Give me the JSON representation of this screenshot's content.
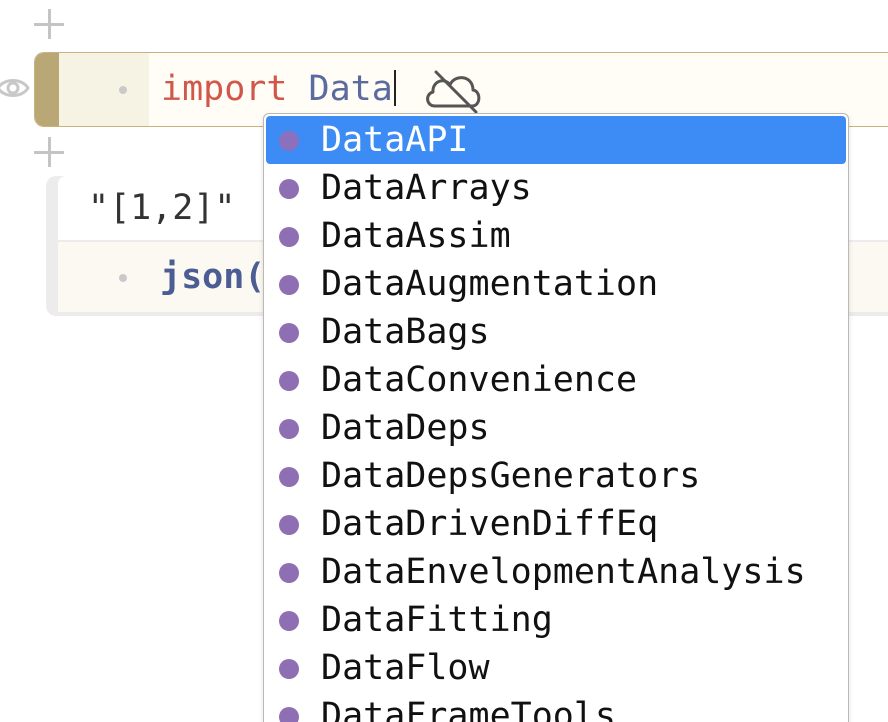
{
  "cell1": {
    "keyword": "import",
    "typed": "Data",
    "status_icon": "cloud-off-icon"
  },
  "cell2": {
    "output": "\"[1,2]\"",
    "code": "json("
  },
  "autocomplete": {
    "selected_index": 0,
    "items": [
      "DataAPI",
      "DataArrays",
      "DataAssim",
      "DataAugmentation",
      "DataBags",
      "DataConvenience",
      "DataDeps",
      "DataDepsGenerators",
      "DataDrivenDiffEq",
      "DataEnvelopmentAnalysis",
      "DataFitting",
      "DataFlow",
      "DataFrameTools"
    ]
  },
  "colors": {
    "keyword": "#d0574a",
    "module": "#5a6ba0",
    "selection": "#3d8cf5",
    "completion_dot": "#8e6fb4",
    "cell_accent": "#b9a876"
  }
}
